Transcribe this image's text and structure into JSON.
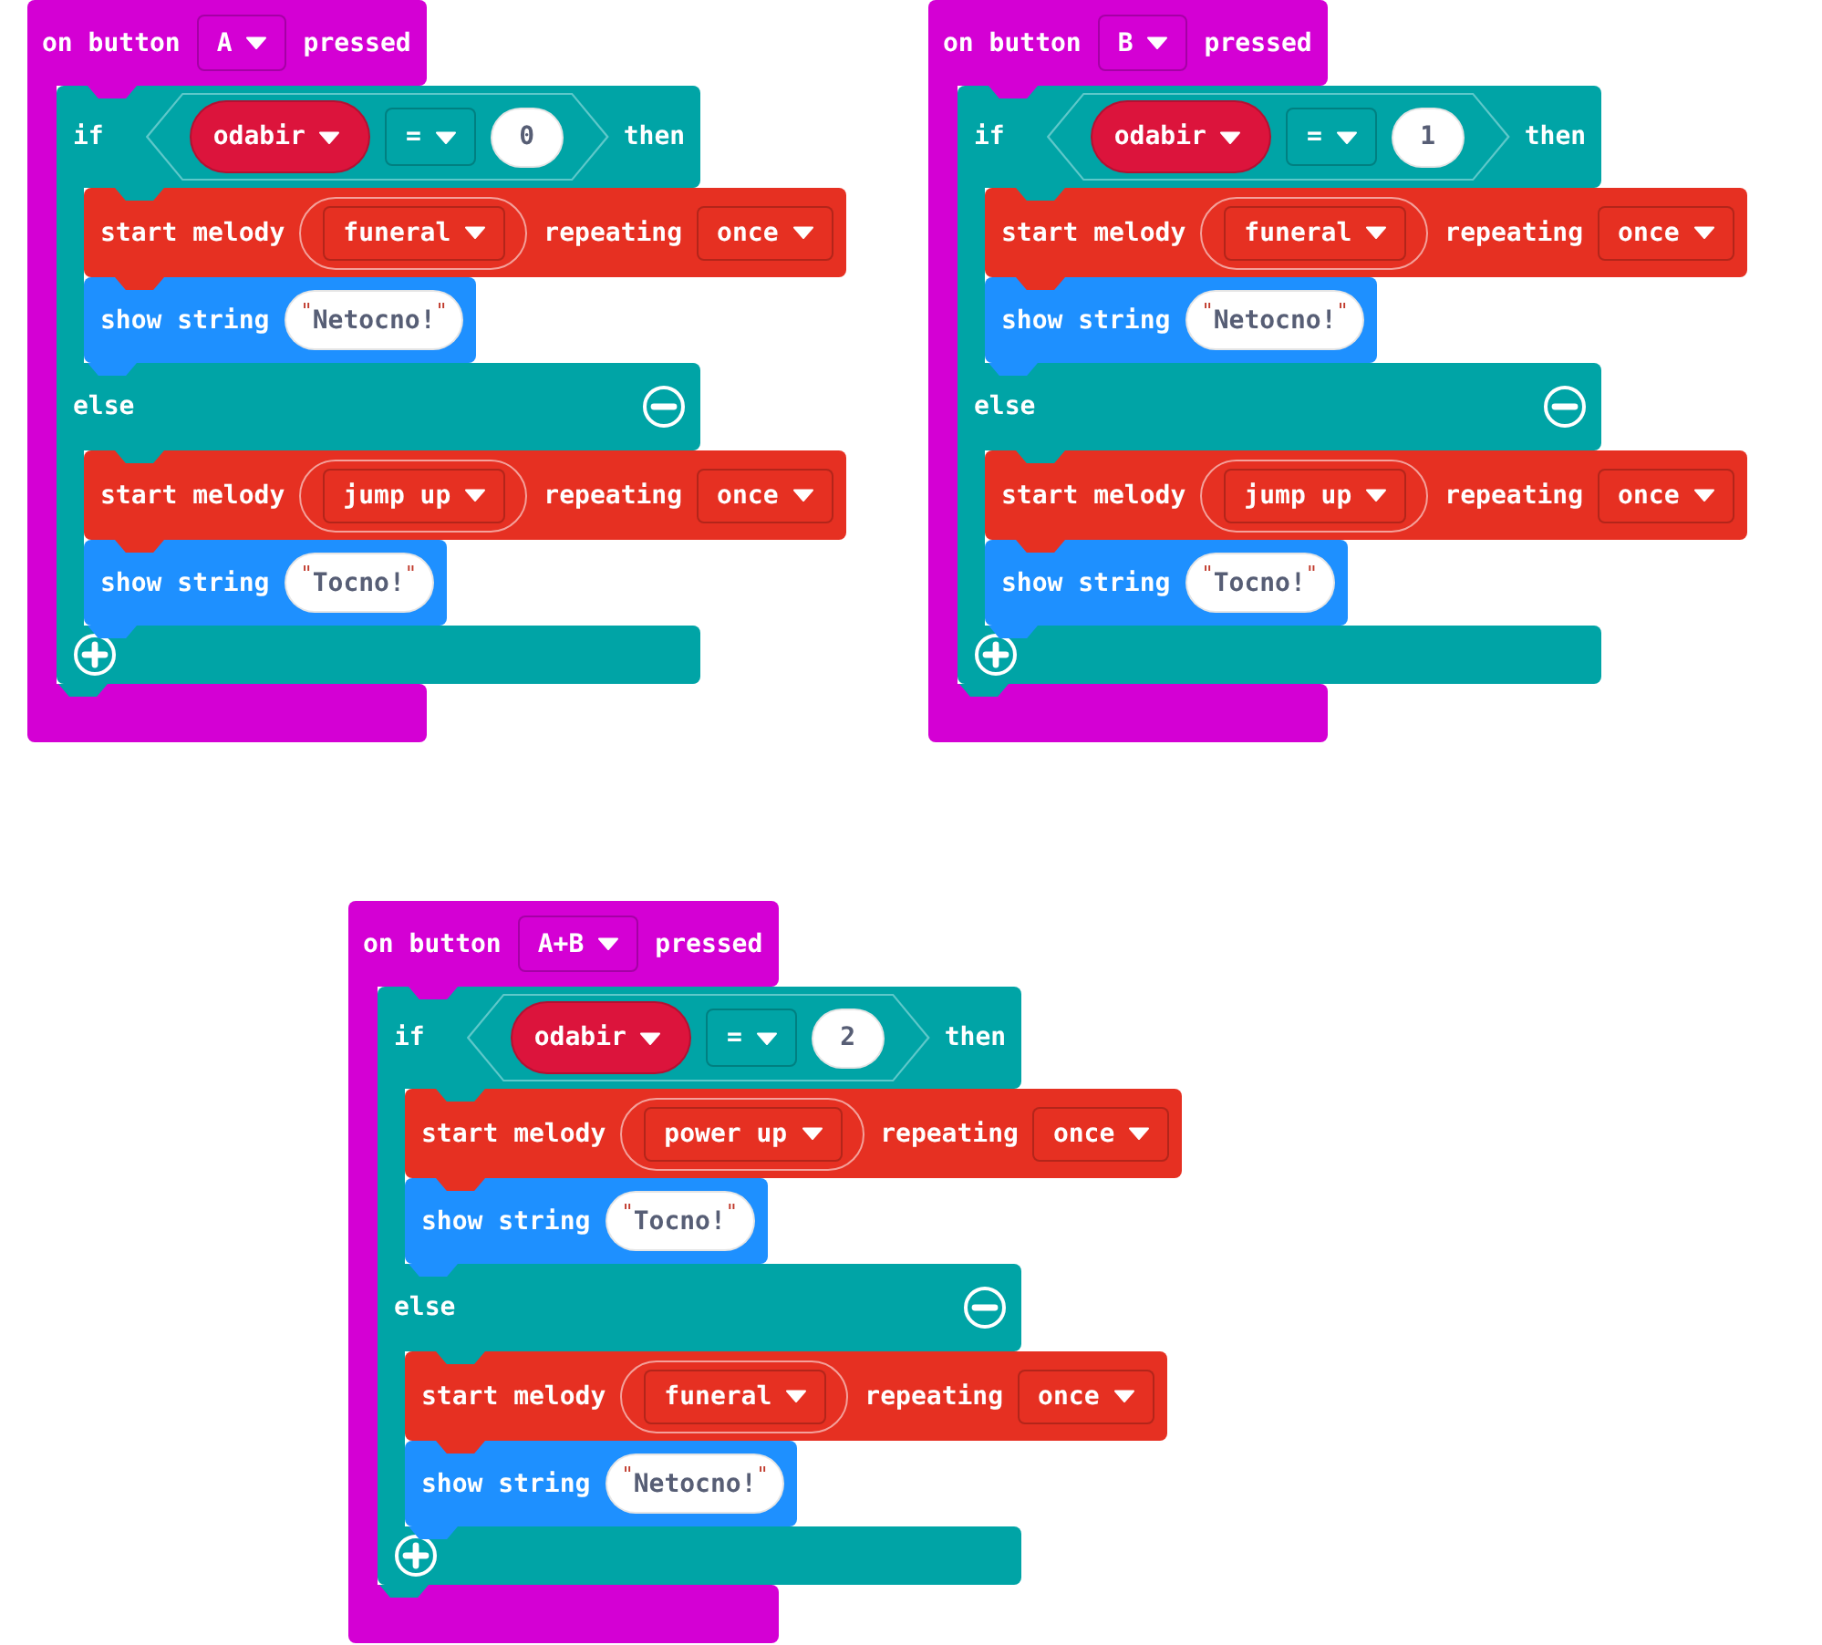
{
  "scripts": [
    {
      "event": {
        "label": "on button",
        "button": "A",
        "suffix": "pressed"
      },
      "if_block": {
        "if_label": "if",
        "condition": {
          "variable": "odabir",
          "operator": "=",
          "value": "0"
        },
        "then_label": "then",
        "then": [
          {
            "kind": "melody",
            "label": "start melody",
            "melody": "funeral",
            "repeat_label": "repeating",
            "repeat": "once"
          },
          {
            "kind": "show_string",
            "label": "show string",
            "open_quote": "\"",
            "text": "Netocno!",
            "close_quote": "\""
          }
        ],
        "else_label": "else",
        "else": [
          {
            "kind": "melody",
            "label": "start melody",
            "melody": "jump up",
            "repeat_label": "repeating",
            "repeat": "once"
          },
          {
            "kind": "show_string",
            "label": "show string",
            "open_quote": "\"",
            "text": "Tocno!",
            "close_quote": "\""
          }
        ]
      }
    },
    {
      "event": {
        "label": "on button",
        "button": "B",
        "suffix": "pressed"
      },
      "if_block": {
        "if_label": "if",
        "condition": {
          "variable": "odabir",
          "operator": "=",
          "value": "1"
        },
        "then_label": "then",
        "then": [
          {
            "kind": "melody",
            "label": "start melody",
            "melody": "funeral",
            "repeat_label": "repeating",
            "repeat": "once"
          },
          {
            "kind": "show_string",
            "label": "show string",
            "open_quote": "\"",
            "text": "Netocno!",
            "close_quote": "\""
          }
        ],
        "else_label": "else",
        "else": [
          {
            "kind": "melody",
            "label": "start melody",
            "melody": "jump up",
            "repeat_label": "repeating",
            "repeat": "once"
          },
          {
            "kind": "show_string",
            "label": "show string",
            "open_quote": "\"",
            "text": "Tocno!",
            "close_quote": "\""
          }
        ]
      }
    },
    {
      "event": {
        "label": "on button",
        "button": "A+B",
        "suffix": "pressed"
      },
      "if_block": {
        "if_label": "if",
        "condition": {
          "variable": "odabir",
          "operator": "=",
          "value": "2"
        },
        "then_label": "then",
        "then": [
          {
            "kind": "melody",
            "label": "start melody",
            "melody": "power up",
            "repeat_label": "repeating",
            "repeat": "once"
          },
          {
            "kind": "show_string",
            "label": "show string",
            "open_quote": "\"",
            "text": "Tocno!",
            "close_quote": "\""
          }
        ],
        "else_label": "else",
        "else": [
          {
            "kind": "melody",
            "label": "start melody",
            "melody": "funeral",
            "repeat_label": "repeating",
            "repeat": "once"
          },
          {
            "kind": "show_string",
            "label": "show string",
            "open_quote": "\"",
            "text": "Netocno!",
            "close_quote": "\""
          }
        ]
      }
    }
  ]
}
